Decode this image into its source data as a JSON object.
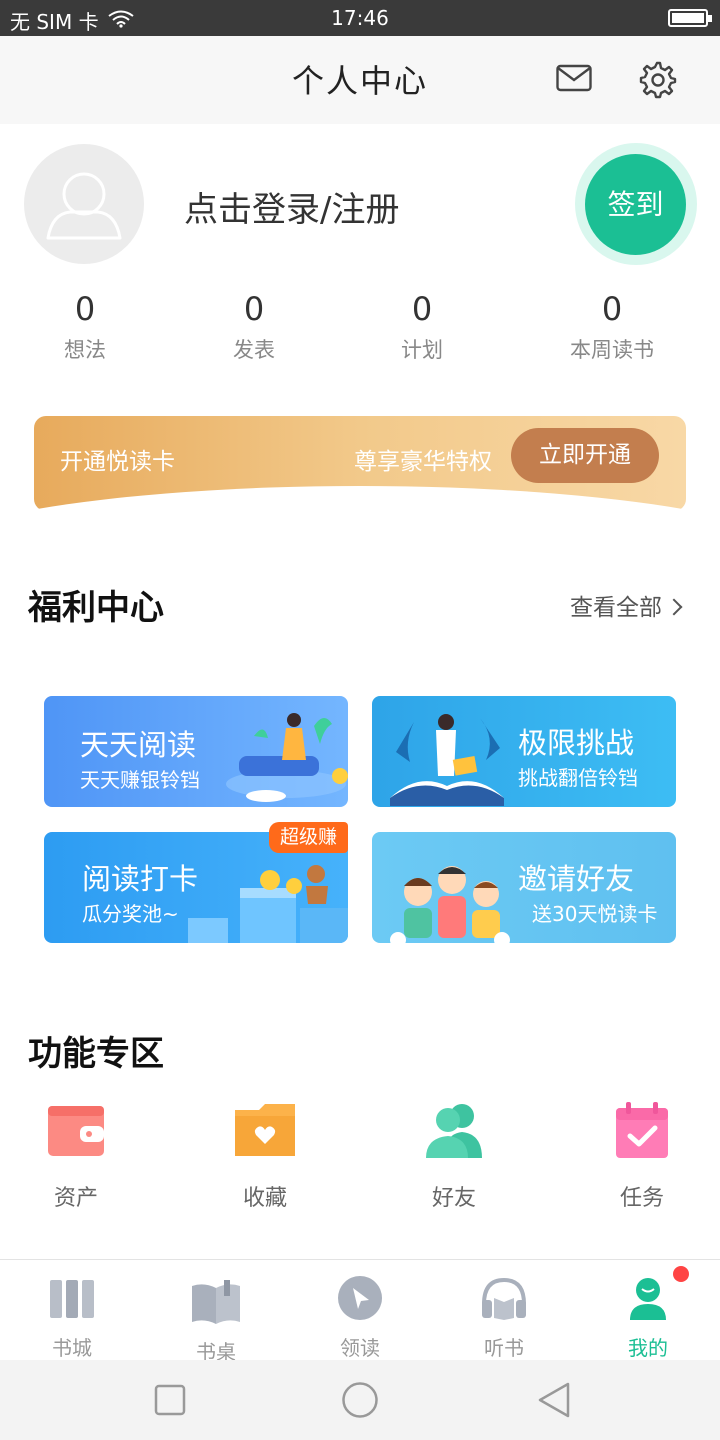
{
  "status_bar": {
    "carrier": "无 SIM 卡",
    "time": "17:46"
  },
  "header": {
    "title": "个人中心"
  },
  "profile": {
    "login_text": "点击登录/注册",
    "checkin_label": "签到"
  },
  "stats": [
    {
      "value": "0",
      "label": "想法"
    },
    {
      "value": "0",
      "label": "发表"
    },
    {
      "value": "0",
      "label": "计划"
    },
    {
      "value": "0",
      "label": "本周读书"
    }
  ],
  "vip_banner": {
    "left_text": "开通悦读卡",
    "mid_text": "尊享豪华特权",
    "button": "立即开通"
  },
  "welfare": {
    "title": "福利中心",
    "see_all": "查看全部",
    "cards": [
      {
        "title": "天天阅读",
        "subtitle": "天天赚银铃铛"
      },
      {
        "title": "极限挑战",
        "subtitle": "挑战翻倍铃铛"
      },
      {
        "title": "阅读打卡",
        "subtitle": "瓜分奖池~",
        "badge": "超级赚"
      },
      {
        "title": "邀请好友",
        "subtitle": "送30天悦读卡"
      }
    ]
  },
  "functions": {
    "title": "功能专区",
    "items": [
      {
        "label": "资产",
        "icon": "wallet-icon"
      },
      {
        "label": "收藏",
        "icon": "folder-heart-icon"
      },
      {
        "label": "好友",
        "icon": "friends-icon"
      },
      {
        "label": "任务",
        "icon": "calendar-check-icon"
      }
    ]
  },
  "bottom_nav": [
    {
      "label": "书城",
      "icon": "bookshelf-icon"
    },
    {
      "label": "书桌",
      "icon": "open-book-icon"
    },
    {
      "label": "领读",
      "icon": "cursor-icon"
    },
    {
      "label": "听书",
      "icon": "headphones-icon"
    },
    {
      "label": "我的",
      "icon": "user-icon",
      "active": true
    }
  ],
  "colors": {
    "accent": "#1bbf94",
    "badge": "#ff6a1a",
    "notification": "#ff4444"
  }
}
